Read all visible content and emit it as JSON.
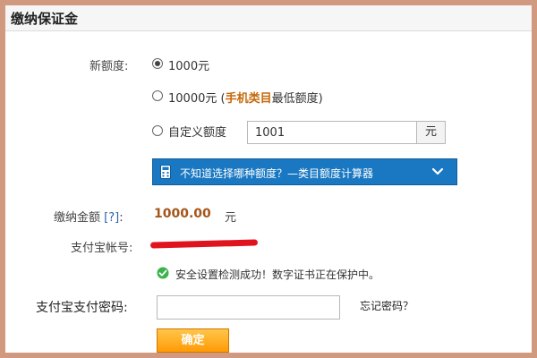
{
  "header": {
    "title": "缴纳保证金"
  },
  "quota": {
    "label": "新额度:",
    "options": [
      {
        "text": "1000元",
        "checked": true
      },
      {
        "prefix": "10000元 (",
        "highlight": "手机类目",
        "suffix": "最低额度)",
        "checked": false
      },
      {
        "text": "自定义额度",
        "checked": false
      }
    ],
    "custom_value": "1001",
    "unit": "元",
    "calculator_text": "不知道选择哪种额度？—类目额度计算器"
  },
  "payment": {
    "label": "缴纳金额",
    "help": "[?]",
    "colon": ":",
    "value": "1000.00",
    "unit": "元"
  },
  "alipay": {
    "account_label": "支付宝帐号:",
    "status_text": "安全设置检测成功！数字证书正在保护中。",
    "password_label": "支付宝支付密码:",
    "forgot_text": "忘记密码？",
    "confirm_label": "确定"
  },
  "colors": {
    "frame": "#d19a80",
    "calculator_bar": "#1a78c2",
    "highlight": "#c56a0a",
    "confirm_button": "#ff9b05",
    "redaction": "#e0141e",
    "success": "#3bb34a"
  }
}
